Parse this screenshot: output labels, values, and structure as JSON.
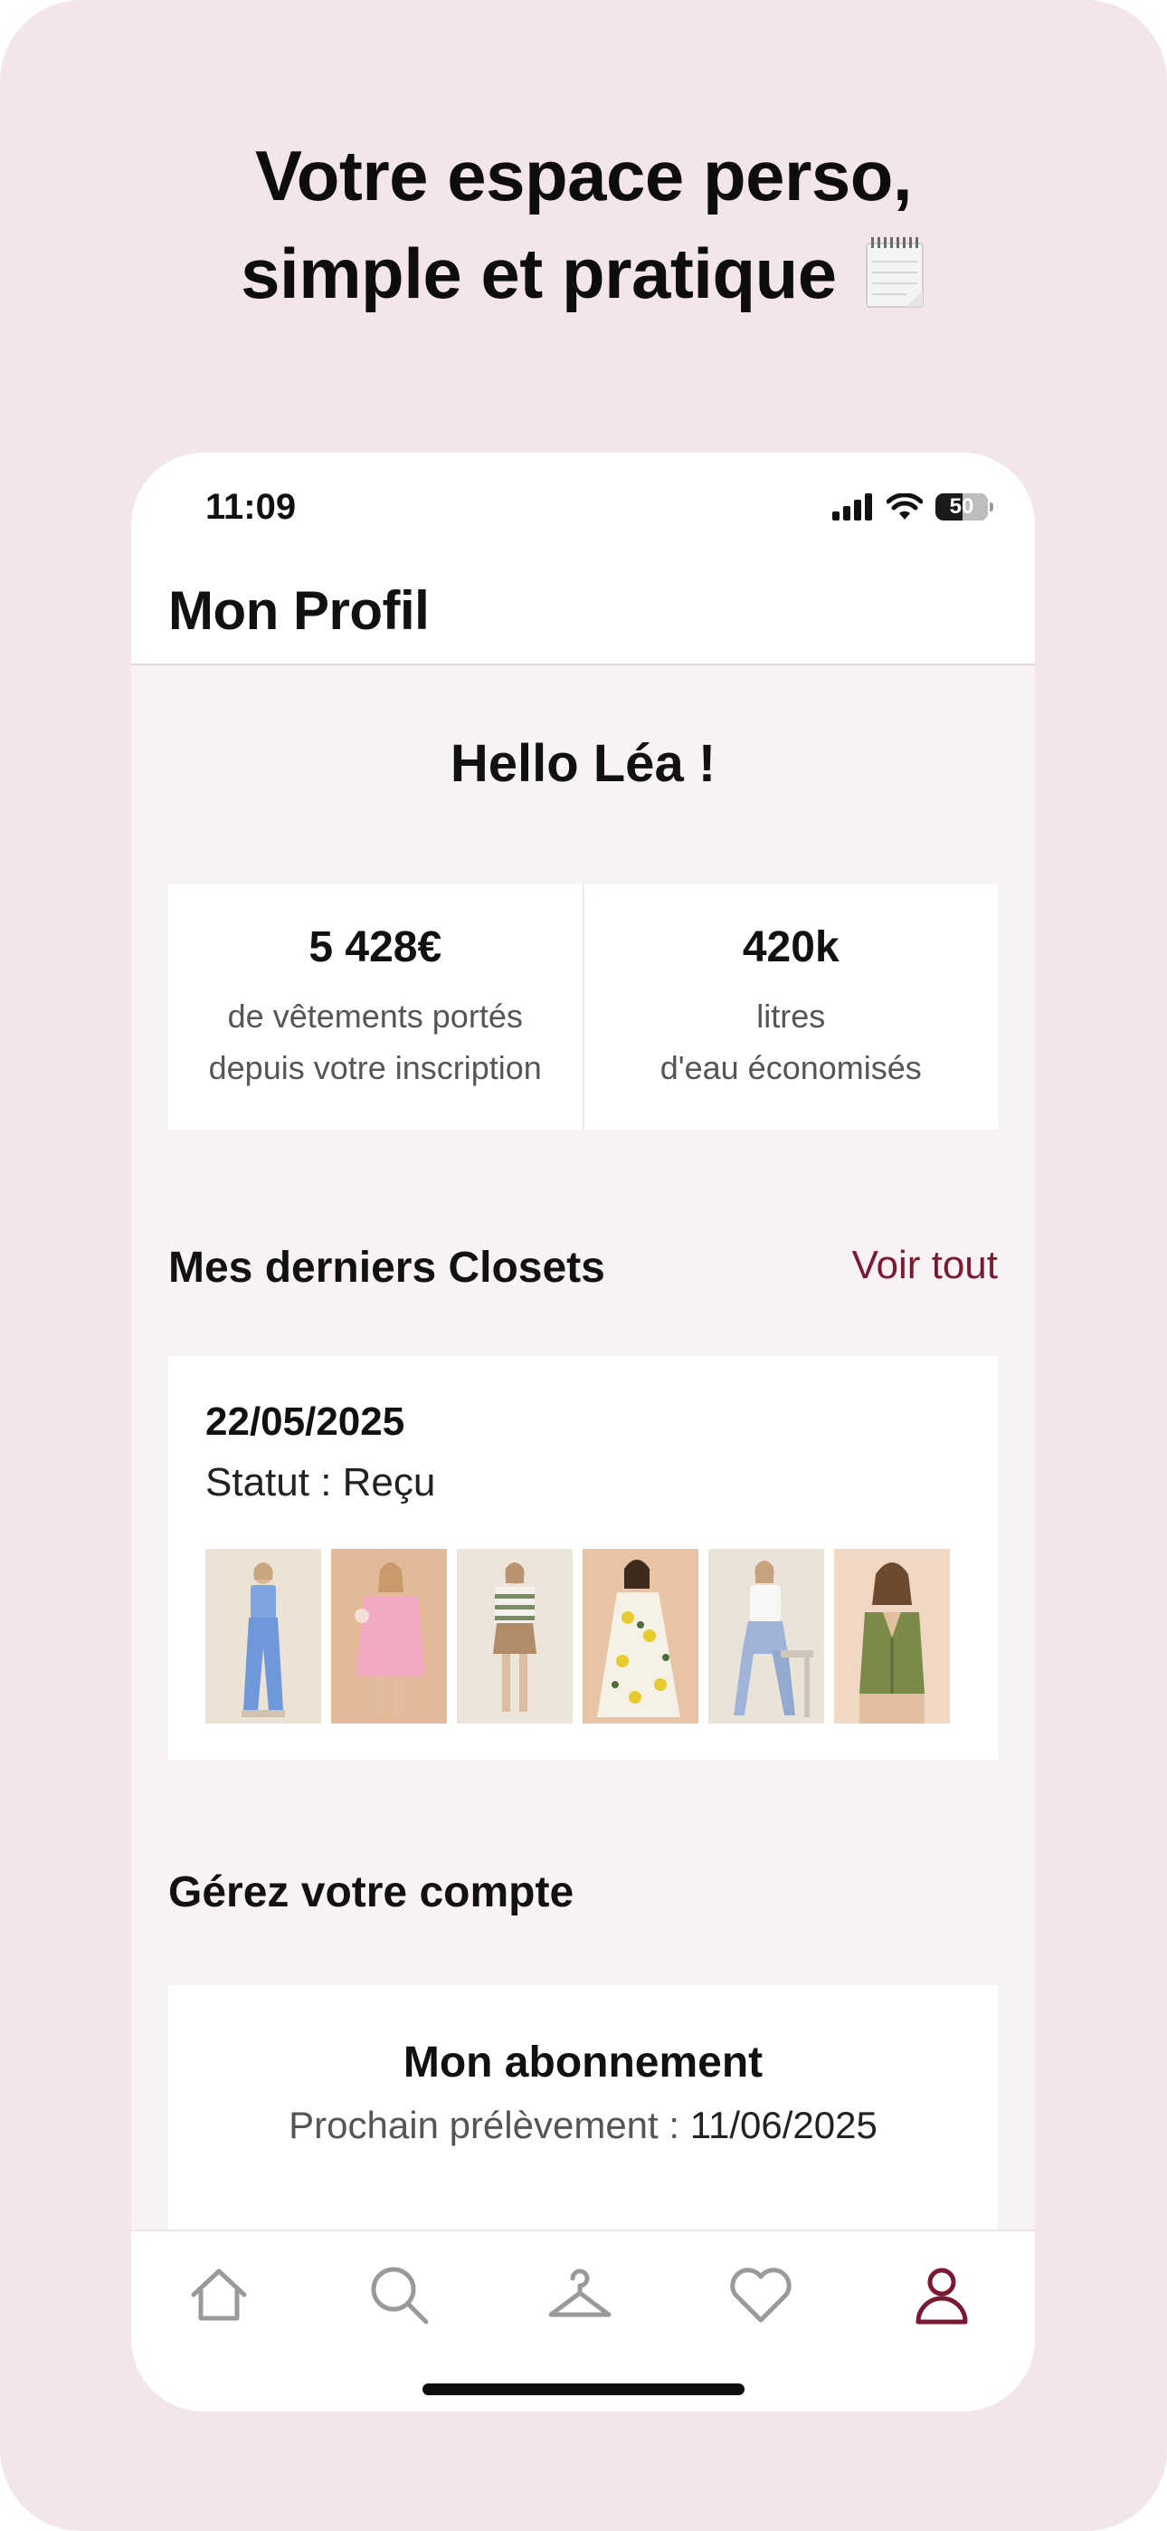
{
  "promo": {
    "headline_line1": "Votre espace perso,",
    "headline_line2": "simple et pratique",
    "headline_icon": "notepad-icon"
  },
  "status_bar": {
    "time": "11:09",
    "battery": "50"
  },
  "header": {
    "title": "Mon Profil"
  },
  "greeting": "Hello Léa !",
  "stats": [
    {
      "value": "5 428€",
      "label_line1": "de vêtements portés",
      "label_line2": "depuis votre inscription"
    },
    {
      "value": "420k",
      "label_line1": "litres",
      "label_line2": "d'eau économisés"
    }
  ],
  "closets": {
    "title": "Mes derniers Closets",
    "see_all": "Voir tout",
    "latest": {
      "date": "22/05/2025",
      "status": "Statut : Reçu",
      "item_count": 6
    }
  },
  "account": {
    "title": "Gérez votre compte",
    "subscription_title": "Mon abonnement",
    "next_payment_label": "Prochain prélèvement :",
    "next_payment_date": "11/06/2025"
  },
  "tabs": [
    {
      "icon": "home-icon",
      "active": false
    },
    {
      "icon": "search-icon",
      "active": false
    },
    {
      "icon": "hanger-icon",
      "active": false
    },
    {
      "icon": "heart-icon",
      "active": false
    },
    {
      "icon": "profile-icon",
      "active": true
    }
  ],
  "colors": {
    "background": "#f3e5e8",
    "accent": "#7a1930",
    "screen": "#f8f2f4"
  }
}
